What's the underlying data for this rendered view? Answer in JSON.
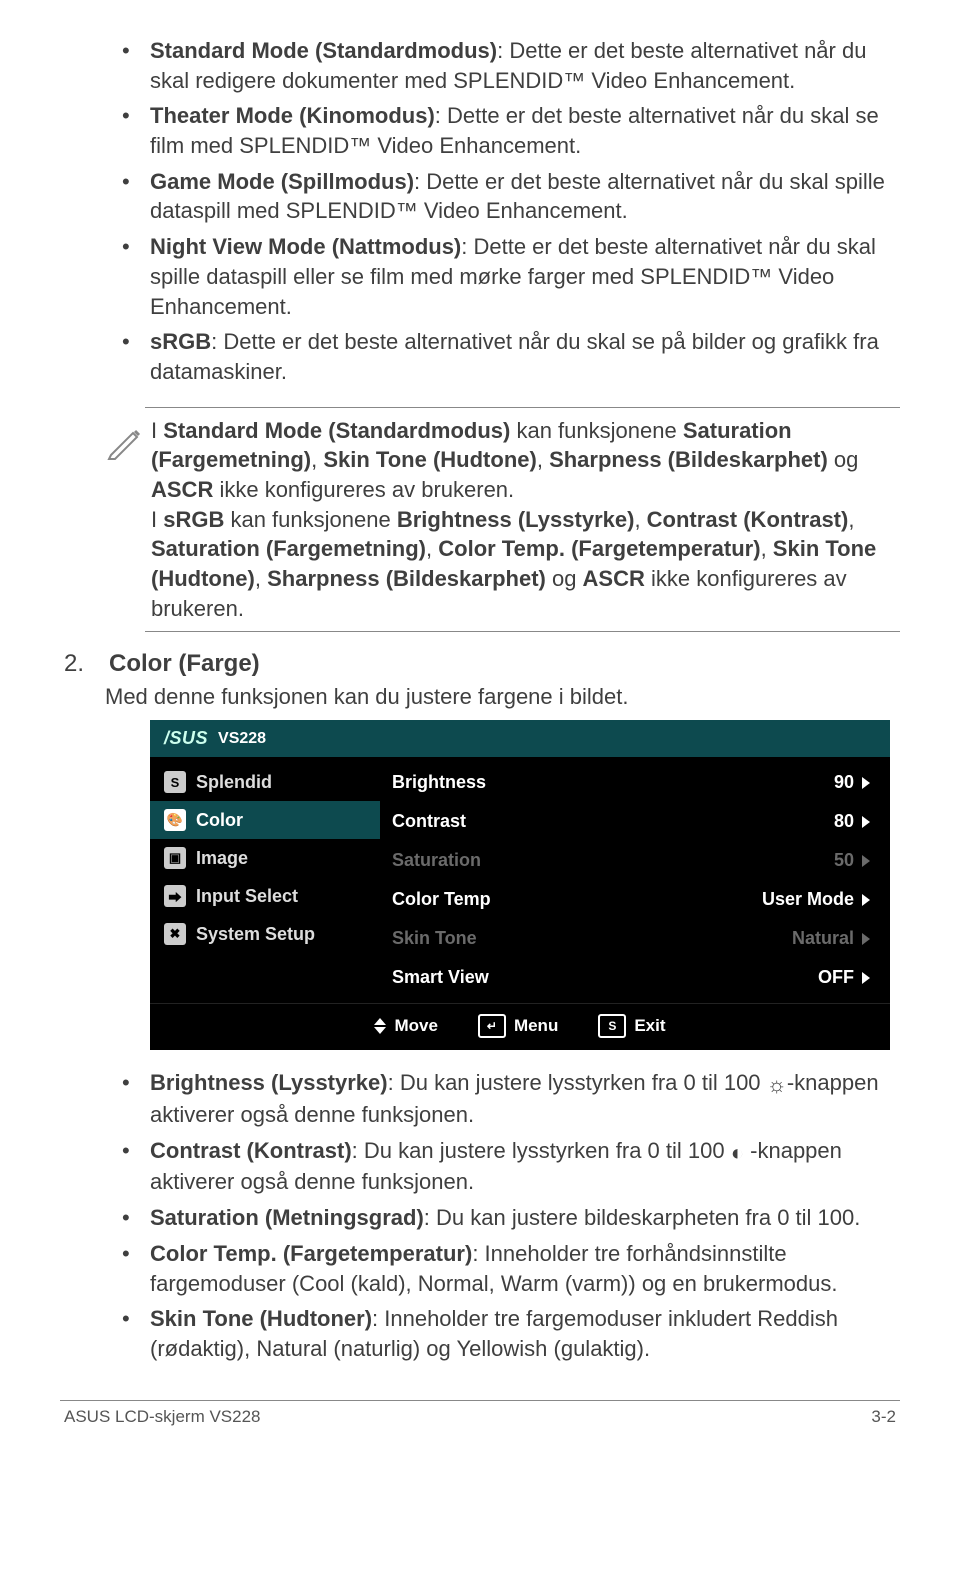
{
  "modes": {
    "standard": {
      "title": "Standard Mode (Standardmodus)",
      "text": ": Dette er det beste alternativet når du skal redigere dokumenter med SPLENDID™ Video Enhancement."
    },
    "theater": {
      "title": "Theater Mode (Kinomodus)",
      "text": ": Dette er det beste alternativet når du skal se film med SPLENDID™ Video Enhancement."
    },
    "game": {
      "title": "Game Mode (Spillmodus)",
      "text": ": Dette er det beste alternativet når du skal spille dataspill med SPLENDID™ Video Enhancement."
    },
    "night": {
      "title": "Night View Mode (Nattmodus)",
      "text": ": Dette er det beste alternativet når du skal spille dataspill eller se film med mørke farger med SPLENDID™ Video Enhancement."
    },
    "srgb": {
      "title": "sRGB",
      "text": ": Dette er det beste alternativet når du skal se på bilder og grafikk fra datamaskiner."
    }
  },
  "note": {
    "p1_a": "I ",
    "p1_b": "Standard Mode (Standardmodus)",
    "p1_c": " kan funksjonene ",
    "p1_d": "Saturation (Fargemetning)",
    "p1_e": ", ",
    "p1_f": "Skin Tone (Hudtone)",
    "p1_g": ", ",
    "p1_h": "Sharpness (Bildeskarphet)",
    "p1_i": " og ",
    "p1_j": "ASCR",
    "p1_k": " ikke konfigureres av brukeren.",
    "p2_a": "I ",
    "p2_b": "sRGB",
    "p2_c": " kan funksjonene ",
    "p2_d": "Brightness (Lysstyrke)",
    "p2_e": ", ",
    "p2_f": "Contrast (Kontrast)",
    "p2_g": ", ",
    "p2_h": "Saturation (Fargemetning)",
    "p2_i": ", ",
    "p2_j": "Color Temp. (Fargetemperatur)",
    "p2_k": ", ",
    "p2_l": "Skin Tone (Hudtone)",
    "p2_m": ", ",
    "p2_n": "Sharpness (Bildeskarphet)",
    "p2_o": " og ",
    "p2_p": "ASCR",
    "p2_q": " ikke konfigureres av brukeren."
  },
  "section2": {
    "num": "2.",
    "title": "Color (Farge)",
    "desc": "Med denne funksjonen kan du justere fargene i bildet."
  },
  "osd": {
    "model": "VS228",
    "left": {
      "splendid": "Splendid",
      "color": "Color",
      "image": "Image",
      "input": "Input Select",
      "system": "System Setup"
    },
    "right": {
      "brightness": {
        "label": "Brightness",
        "value": "90"
      },
      "contrast": {
        "label": "Contrast",
        "value": "80"
      },
      "saturation": {
        "label": "Saturation",
        "value": "50"
      },
      "colortemp": {
        "label": "Color Temp",
        "value": "User Mode"
      },
      "skintone": {
        "label": "Skin Tone",
        "value": "Natural"
      },
      "smartview": {
        "label": "Smart View",
        "value": "OFF"
      }
    },
    "footer": {
      "move": "Move",
      "menu": "Menu",
      "exit": "Exit",
      "exit_key": "S"
    }
  },
  "params": {
    "brightness": {
      "title": "Brightness (Lysstyrke)",
      "text1": ": Du kan justere lysstyrken fra 0 til 100 ",
      "text2": "-knappen aktiverer også denne funksjonen."
    },
    "contrast": {
      "title": "Contrast (Kontrast)",
      "text1": ": Du kan justere lysstyrken fra 0 til 100 ",
      "text2": " -knappen aktiverer også denne funksjonen."
    },
    "saturation": {
      "title": "Saturation (Metningsgrad)",
      "text": ": Du kan justere bildeskarpheten fra 0 til 100."
    },
    "colortemp": {
      "title": "Color Temp. (Fargetemperatur)",
      "text": ": Inneholder tre forhåndsinnstilte fargemoduser (Cool (kald), Normal, Warm (varm)) og en brukermodus."
    },
    "skintone": {
      "title": "Skin Tone (Hudtoner)",
      "text": ": Inneholder tre fargemoduser inkludert Reddish (rødaktig), Natural (naturlig) og Yellowish (gulaktig)."
    }
  },
  "footer": {
    "left": "ASUS LCD-skjerm VS228",
    "right": "3-2"
  },
  "chart_data": {
    "type": "table",
    "title": "VS228 Color OSD",
    "series": [
      {
        "name": "Brightness",
        "values": [
          90
        ]
      },
      {
        "name": "Contrast",
        "values": [
          80
        ]
      },
      {
        "name": "Saturation",
        "values": [
          50
        ]
      },
      {
        "name": "Color Temp",
        "values": [
          "User Mode"
        ]
      },
      {
        "name": "Skin Tone",
        "values": [
          "Natural"
        ]
      },
      {
        "name": "Smart View",
        "values": [
          "OFF"
        ]
      }
    ]
  }
}
